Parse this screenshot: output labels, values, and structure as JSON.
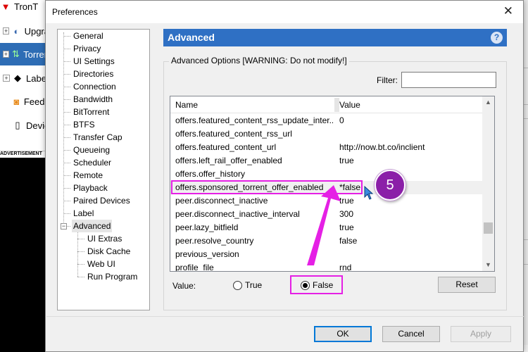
{
  "background_app": {
    "sidebar": [
      {
        "label": "TronT",
        "icon": "tron-icon"
      },
      {
        "label": "Upgra",
        "icon": "upgrade-icon"
      },
      {
        "label": "Torren",
        "icon": "torrents-icon"
      },
      {
        "label": "Label",
        "icon": "label-icon"
      },
      {
        "label": "Feeds",
        "icon": "feeds-icon"
      },
      {
        "label": "Devic",
        "icon": "device-icon"
      }
    ],
    "advertisement": "ADVERTISEMENT"
  },
  "dialog": {
    "title": "Preferences",
    "close_glyph": "✕",
    "tree": [
      {
        "label": "General"
      },
      {
        "label": "Privacy"
      },
      {
        "label": "UI Settings"
      },
      {
        "label": "Directories"
      },
      {
        "label": "Connection"
      },
      {
        "label": "Bandwidth"
      },
      {
        "label": "BitTorrent"
      },
      {
        "label": "BTFS"
      },
      {
        "label": "Transfer Cap"
      },
      {
        "label": "Queueing"
      },
      {
        "label": "Scheduler"
      },
      {
        "label": "Remote"
      },
      {
        "label": "Playback"
      },
      {
        "label": "Paired Devices"
      },
      {
        "label": "Label"
      },
      {
        "label": "Advanced",
        "expander": "−"
      },
      {
        "label": "UI Extras"
      },
      {
        "label": "Disk Cache"
      },
      {
        "label": "Web UI"
      },
      {
        "label": "Run Program"
      }
    ],
    "panel_title": "Advanced",
    "help_glyph": "?",
    "group_label": "Advanced Options [WARNING: Do not modify!]",
    "filter_label": "Filter:",
    "filter_value": "",
    "columns": {
      "name": "Name",
      "value": "Value"
    },
    "rows": [
      {
        "name": "offers.featured_content_rss_update_inter...",
        "value": "0"
      },
      {
        "name": "offers.featured_content_rss_url",
        "value": ""
      },
      {
        "name": "offers.featured_content_url",
        "value": "http://now.bt.co/inclient"
      },
      {
        "name": "offers.left_rail_offer_enabled",
        "value": "true"
      },
      {
        "name": "offers.offer_history",
        "value": ""
      },
      {
        "name": "offers.sponsored_torrent_offer_enabled",
        "value": "*false"
      },
      {
        "name": "peer.disconnect_inactive",
        "value": "true"
      },
      {
        "name": "peer.disconnect_inactive_interval",
        "value": "300"
      },
      {
        "name": "peer.lazy_bitfield",
        "value": "true"
      },
      {
        "name": "peer.resolve_country",
        "value": "false"
      },
      {
        "name": "previous_version",
        "value": ""
      },
      {
        "name": "profile_file",
        "value": "rnd"
      }
    ],
    "value_label": "Value:",
    "radio_true": "True",
    "radio_false": "False",
    "selected_radio": "False",
    "reset": "Reset",
    "ok": "OK",
    "cancel": "Cancel",
    "apply": "Apply"
  },
  "annotation": {
    "step_number": "5",
    "color": "#e520e5"
  }
}
